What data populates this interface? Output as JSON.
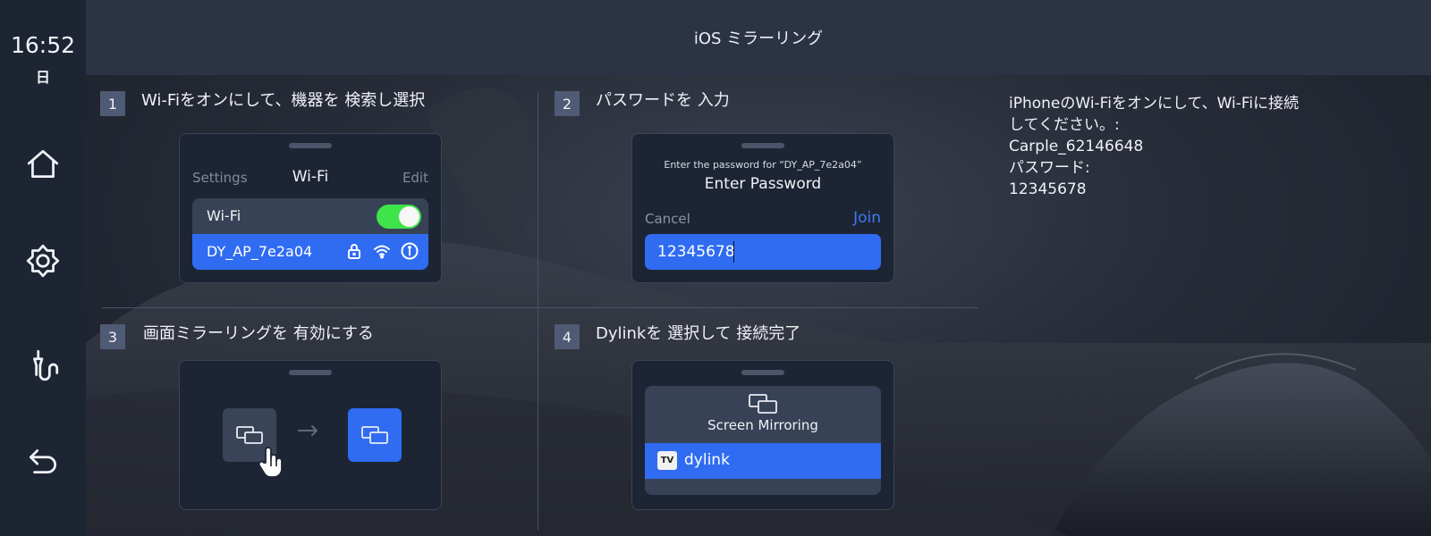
{
  "status": {
    "time": "16:52",
    "day": "日"
  },
  "header": {
    "title": "iOS ミラーリング"
  },
  "rail": {
    "items": [
      {
        "icon": "home-icon"
      },
      {
        "icon": "brightness-icon"
      },
      {
        "icon": "hvac-icon"
      },
      {
        "icon": "back-icon"
      }
    ]
  },
  "steps": [
    {
      "num": "1",
      "title": "Wi-Fiをオンにして、機器を 検索し選択",
      "settings": "Settings",
      "wifi_title": "Wi-Fi",
      "edit": "Edit",
      "wifi_row_label": "Wi-Fi",
      "wifi_on": true,
      "network": "DY_AP_7e2a04"
    },
    {
      "num": "2",
      "title": "パスワードを 入力",
      "hint": "Enter the password for “DY_AP_7e2a04”",
      "dialog_title": "Enter Password",
      "cancel": "Cancel",
      "join": "Join",
      "password_value": "12345678"
    },
    {
      "num": "3",
      "title": "画面ミラーリングを 有効にする"
    },
    {
      "num": "4",
      "title": "Dylinkを 選択して 接続完了",
      "mirroring_label": "Screen Mirroring",
      "tv_badge": "TV",
      "device": "dylink"
    }
  ],
  "info": {
    "line1": "iPhoneのWi-Fiをオンにして、Wi-Fiに接続",
    "line2": "してください。:",
    "line3": "Carple_62146648",
    "line4": "パスワード:",
    "line5": "12345678"
  },
  "colors": {
    "accent": "#2f6cf2",
    "toggle_on": "#3fe34a",
    "rail_bg": "#1e2532",
    "header_bg": "#2b3345"
  }
}
